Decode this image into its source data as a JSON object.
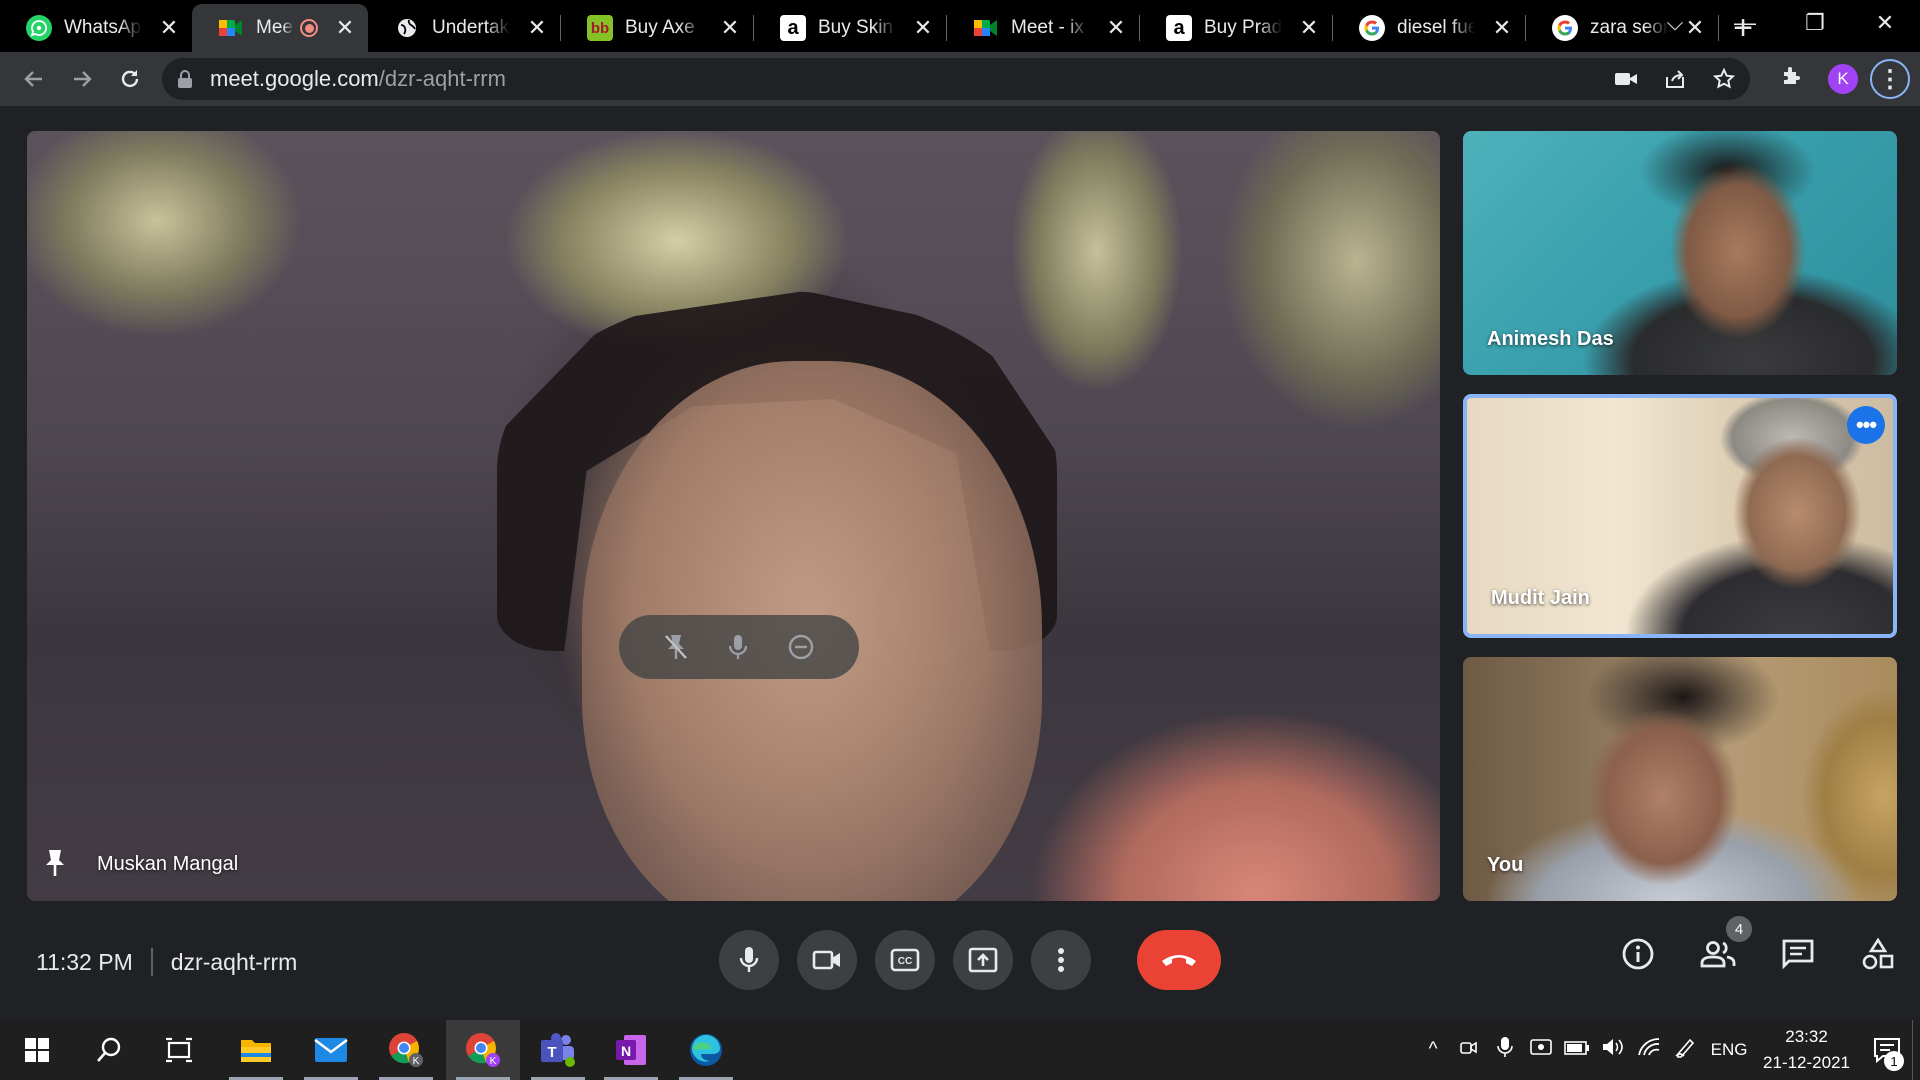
{
  "browser": {
    "tabs": [
      {
        "title": "WhatsApp",
        "icon": "whatsapp-icon",
        "color": "#25d366"
      },
      {
        "title": "Meet",
        "icon": "google-meet-icon",
        "color": "#00897b",
        "recording": true
      },
      {
        "title": "Undertaking",
        "icon": "globe-icon",
        "color": "#e8eaed"
      },
      {
        "title": "Buy Axe",
        "icon": "bigbasket-icon",
        "color": "#84c225"
      },
      {
        "title": "Buy Skin",
        "icon": "amazon-icon",
        "color": "#ffffff"
      },
      {
        "title": "Meet - ix",
        "icon": "google-meet-icon",
        "color": "#00897b"
      },
      {
        "title": "Buy Prada",
        "icon": "amazon-icon",
        "color": "#ffffff"
      },
      {
        "title": "diesel fuel",
        "icon": "google-icon",
        "color": "#ffffff"
      },
      {
        "title": "zara seor",
        "icon": "google-icon",
        "color": "#ffffff"
      }
    ],
    "new_tab": "+",
    "url_host": "meet.google.com",
    "url_path": "/dzr-aqht-rrm",
    "profile_initial": "K"
  },
  "meet": {
    "main_participant": "Muskan Mangal",
    "participants": [
      {
        "name": "Animesh Das"
      },
      {
        "name": "Mudit Jain",
        "highlighted": true
      },
      {
        "name": "You"
      }
    ],
    "time": "11:32 PM",
    "meeting_code": "dzr-aqht-rrm",
    "people_count": "4",
    "accent": "#8ab4f8",
    "hangup_color": "#ea4335"
  },
  "taskbar": {
    "apps": [
      {
        "name": "windows-start-icon"
      },
      {
        "name": "search-icon"
      },
      {
        "name": "task-view-icon"
      },
      {
        "name": "file-explorer-icon"
      },
      {
        "name": "mail-icon"
      },
      {
        "name": "chrome-profile-icon"
      },
      {
        "name": "chrome-active-icon"
      },
      {
        "name": "teams-icon"
      },
      {
        "name": "onenote-icon"
      },
      {
        "name": "edge-icon"
      }
    ],
    "language": "ENG",
    "clock_time": "23:32",
    "clock_date": "21-12-2021",
    "notification_count": "1"
  }
}
